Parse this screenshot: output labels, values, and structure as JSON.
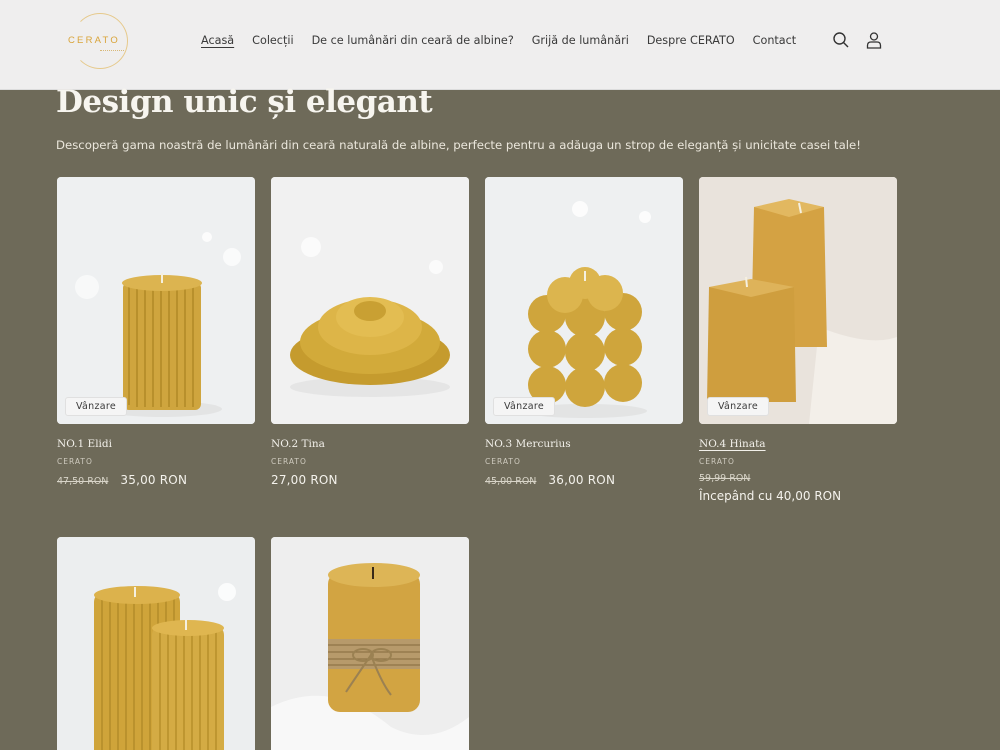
{
  "brand": {
    "logo_text": "CERATO"
  },
  "nav": {
    "items": [
      {
        "label": "Acasă",
        "active": true
      },
      {
        "label": "Colecții"
      },
      {
        "label": "De ce lumânări din ceară de albine?"
      },
      {
        "label": "Grijă de lumânări"
      },
      {
        "label": "Despre CERATO"
      },
      {
        "label": "Contact"
      }
    ],
    "icons": [
      "search-icon",
      "account-icon"
    ]
  },
  "section": {
    "title": "Design unic și elegant",
    "subtitle": "Descoperă gama noastră de lumânări din ceară naturală de albine, perfecte pentru a adăuga un strop de eleganță și unicitate casei tale!"
  },
  "products": [
    {
      "name": "NO.1 Elidi",
      "vendor": "CERATO",
      "badge": "Vânzare",
      "old_price": "47,50 RON",
      "price": "35,00 RON"
    },
    {
      "name": "NO.2 Tina",
      "vendor": "CERATO",
      "price": "27,00 RON"
    },
    {
      "name": "NO.3 Mercurius",
      "vendor": "CERATO",
      "badge": "Vânzare",
      "old_price": "45,00 RON",
      "price": "36,00 RON"
    },
    {
      "name": "NO.4 Hinata",
      "vendor": "CERATO",
      "badge": "Vânzare",
      "old_price": "59,99 RON",
      "price_from": "Începând cu 40,00 RON"
    },
    {
      "name": "",
      "vendor": ""
    },
    {
      "name": "",
      "vendor": ""
    }
  ],
  "colors": {
    "background": "#6e6a59",
    "header": "#efeeee",
    "wax": "#d4a93f"
  }
}
